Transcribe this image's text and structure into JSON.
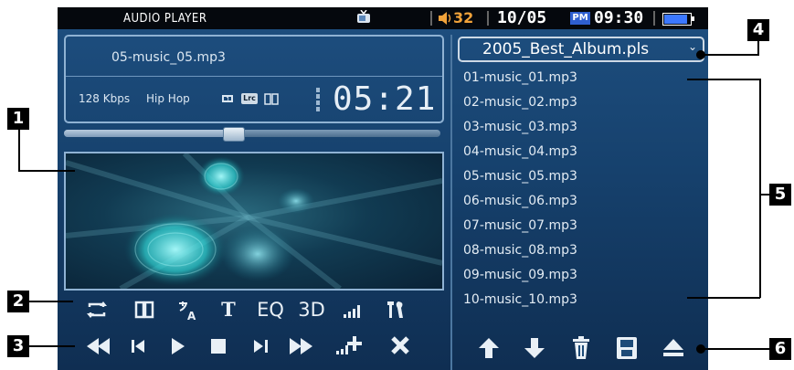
{
  "status_bar": {
    "title": "AUDIO PLAYER",
    "volume": "32",
    "date": "10/05",
    "meridiem": "PM",
    "time": "09:30",
    "battery_level": 0.9,
    "tv_icon": "tv-icon",
    "volume_icon": "speaker-icon"
  },
  "now_playing": {
    "filename": "05-music_05.mp3",
    "bitrate": "128 Kbps",
    "genre": "Hip Hop",
    "elapsed": "05:21",
    "mode_icons": [
      "repeat-one-icon",
      "lyrics-icon",
      "book-icon"
    ],
    "lyrics_label": "Lrc",
    "progress": 0.45
  },
  "toolbar": {
    "items": [
      {
        "name": "repeat",
        "icon": "repeat-icon"
      },
      {
        "name": "book",
        "icon": "book-icon"
      },
      {
        "name": "language",
        "icon": "language-icon"
      },
      {
        "name": "text",
        "label": "T"
      },
      {
        "name": "equalizer",
        "label": "EQ"
      },
      {
        "name": "3d",
        "label": "3D"
      },
      {
        "name": "visualizer",
        "icon": "level-meter-icon"
      },
      {
        "name": "settings",
        "icon": "tools-icon"
      }
    ]
  },
  "transport": {
    "buttons": [
      "rewind-icon",
      "previous-icon",
      "play-icon",
      "stop-icon",
      "next-icon",
      "fast-forward-icon",
      "add-to-playlist-icon",
      "close-icon"
    ]
  },
  "playlist": {
    "selected": "2005_Best_Album.pls",
    "tracks": [
      "01-music_01.mp3",
      "02-music_02.mp3",
      "03-music_03.mp3",
      "04-music_04.mp3",
      "05-music_05.mp3",
      "06-music_06.mp3",
      "07-music_07.mp3",
      "08-music_08.mp3",
      "09-music_09.mp3",
      "10-music_10.mp3"
    ],
    "actions": [
      "move-up-icon",
      "move-down-icon",
      "delete-icon",
      "save-icon",
      "eject-icon"
    ]
  },
  "callouts": [
    "1",
    "2",
    "3",
    "4",
    "5",
    "6"
  ],
  "colors": {
    "screen_bg": "#1a4878",
    "status_bar": "#05080d",
    "volume_number": "#f0a23a",
    "pm_badge": "#2f5fd0",
    "battery": "#3c78ff",
    "visual_glow": "#3ee6e6"
  }
}
